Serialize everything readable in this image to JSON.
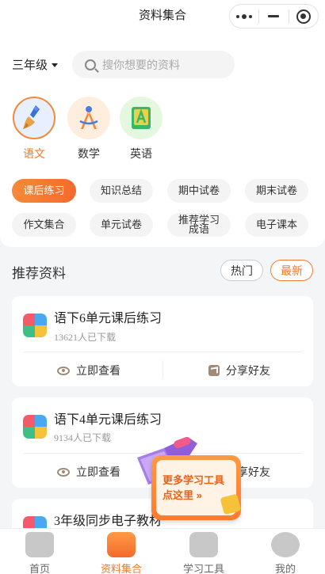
{
  "header": {
    "title": "资料集合"
  },
  "filter": {
    "grade": "三年级",
    "search_placeholder": "搜你想要的资料"
  },
  "subjects": [
    {
      "label": "语文",
      "active": true
    },
    {
      "label": "数学",
      "active": false
    },
    {
      "label": "英语",
      "active": false
    }
  ],
  "categories": {
    "row1": [
      "课后练习",
      "知识总结",
      "期中试卷",
      "期末试卷"
    ],
    "row2": [
      "作文集合",
      "单元试卷",
      "推荐学习成语",
      "电子课本"
    ],
    "active": "课后练习"
  },
  "recommend": {
    "title": "推荐资料",
    "hot_label": "热门",
    "new_label": "最新"
  },
  "cards": [
    {
      "title": "语下6单元课后练习",
      "downloads": "13621人已下载",
      "view_label": "立即查看",
      "share_label": "分享好友"
    },
    {
      "title": "语下4单元课后练习",
      "downloads": "9134人已下载",
      "view_label": "立即查看",
      "share_label": "分享好友"
    },
    {
      "title": "3年级同步电子教材"
    }
  ],
  "promo": {
    "line1": "更多学习工具",
    "line2": "点这里 »"
  },
  "tabbar": {
    "items": [
      "首页",
      "资料集合",
      "学习工具",
      "我的"
    ],
    "active": "资料集合"
  },
  "colors": {
    "accent": "#f07a2c",
    "background": "#f4f5f7"
  }
}
